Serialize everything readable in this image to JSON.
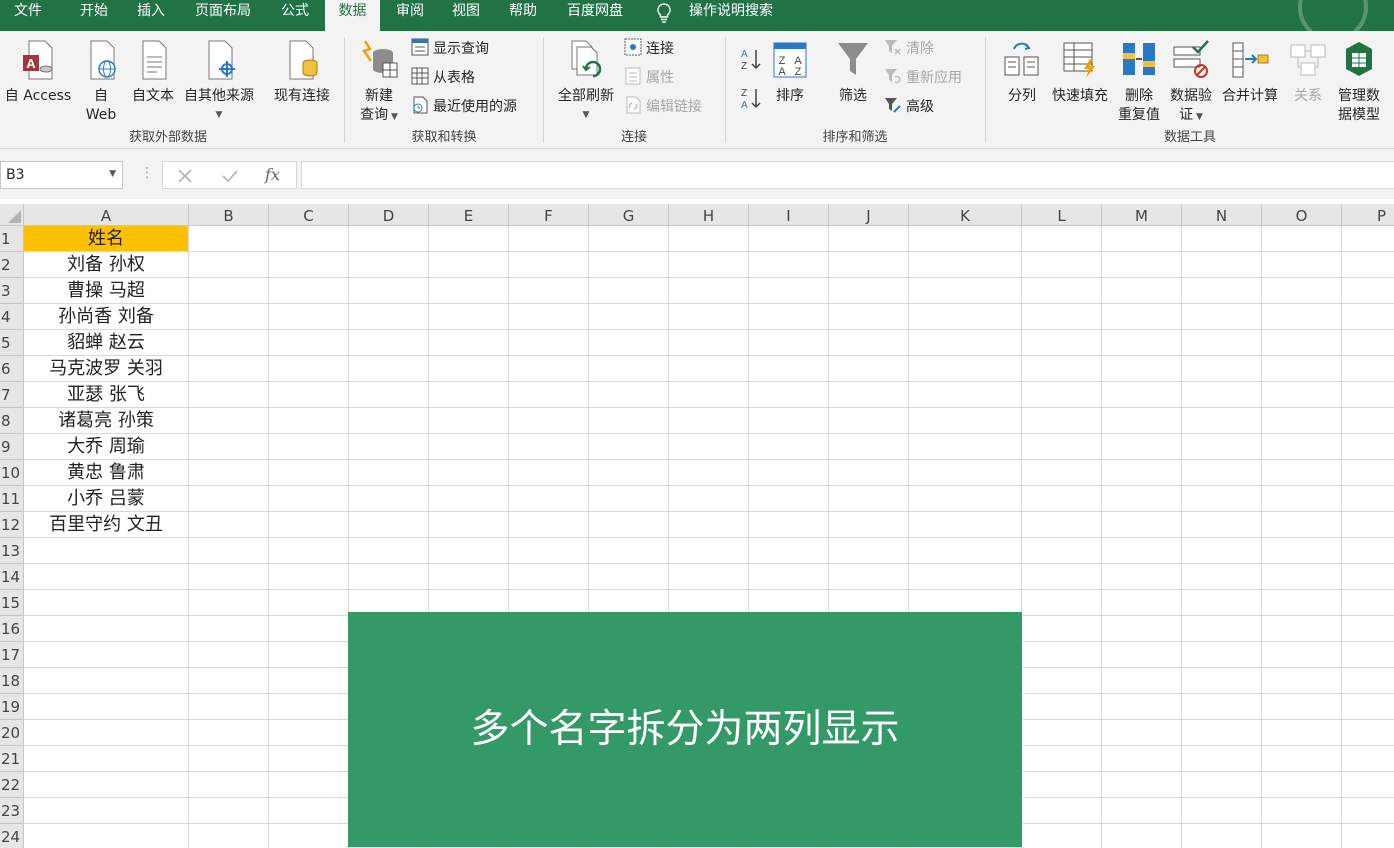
{
  "tabs": [
    {
      "id": "file",
      "label": "文件"
    },
    {
      "id": "home",
      "label": "开始"
    },
    {
      "id": "insert",
      "label": "插入"
    },
    {
      "id": "layout",
      "label": "页面布局"
    },
    {
      "id": "formulas",
      "label": "公式"
    },
    {
      "id": "data",
      "label": "数据",
      "active": true
    },
    {
      "id": "review",
      "label": "审阅"
    },
    {
      "id": "view",
      "label": "视图"
    },
    {
      "id": "help",
      "label": "帮助"
    },
    {
      "id": "baidu",
      "label": "百度网盘"
    }
  ],
  "tell_me": "操作说明搜索",
  "ribbon": {
    "groups": {
      "external": "获取外部数据",
      "transform": "获取和转换",
      "connections": "连接",
      "sortfilter": "排序和筛选",
      "datatools": "数据工具"
    },
    "from_access": "自 Access",
    "from_web_1": "自",
    "from_web_2": "Web",
    "from_text": "自文本",
    "from_other": "自其他来源",
    "existing_conn": "现有连接",
    "new_query_1": "新建",
    "new_query_2": "查询",
    "show_queries": "显示查询",
    "from_table": "从表格",
    "recent_sources": "最近使用的源",
    "refresh_all": "全部刷新",
    "connections": "连接",
    "properties": "属性",
    "edit_links": "编辑链接",
    "sort": "排序",
    "filter": "筛选",
    "clear": "清除",
    "reapply": "重新应用",
    "advanced": "高级",
    "text_to_columns": "分列",
    "flash_fill": "快速填充",
    "remove_dup_1": "删除",
    "remove_dup_2": "重复值",
    "validation_1": "数据验",
    "validation_2": "证",
    "consolidate": "合并计算",
    "relationships": "关系",
    "data_model_1": "管理数",
    "data_model_2": "据模型"
  },
  "formula_bar": {
    "name_box": "B3",
    "fx": "fx",
    "value": ""
  },
  "sheet": {
    "columns": [
      "A",
      "B",
      "C",
      "D",
      "E",
      "F",
      "G",
      "H",
      "I",
      "J",
      "K",
      "L",
      "M",
      "N",
      "O",
      "P"
    ],
    "rows": [
      "1",
      "2",
      "3",
      "4",
      "5",
      "6",
      "7",
      "8",
      "9",
      "10",
      "11",
      "12",
      "13",
      "14",
      "15",
      "16",
      "17",
      "18",
      "19",
      "20",
      "21",
      "22",
      "23",
      "24"
    ],
    "header_cell": "姓名",
    "names": [
      "刘备  孙权",
      "曹操  马超",
      "孙尚香  刘备",
      "貂蝉  赵云",
      "马克波罗  关羽",
      "亚瑟  张飞",
      "诸葛亮  孙策",
      "大乔  周瑜",
      "黄忠  鲁肃",
      "小乔  吕蒙",
      "百里守约  文丑"
    ]
  },
  "banner_text": "多个名字拆分为两列显示",
  "colors": {
    "accent": "#217346",
    "header_fill": "#ffc000",
    "banner": "#339966"
  }
}
